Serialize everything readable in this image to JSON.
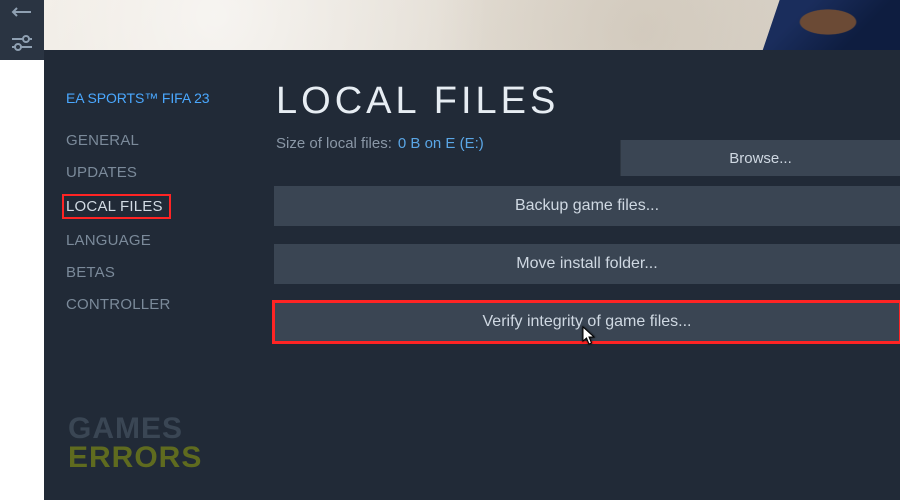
{
  "sidebar": {
    "game_title": "EA SPORTS™ FIFA 23",
    "items": [
      {
        "label": "GENERAL"
      },
      {
        "label": "UPDATES"
      },
      {
        "label": "LOCAL FILES"
      },
      {
        "label": "LANGUAGE"
      },
      {
        "label": "BETAS"
      },
      {
        "label": "CONTROLLER"
      }
    ],
    "selected_index": 2
  },
  "main": {
    "heading": "LOCAL FILES",
    "size_label": "Size of local files:",
    "size_value": "0 B on E (E:)",
    "browse_label": "Browse...",
    "buttons": {
      "backup": "Backup game files...",
      "move": "Move install folder...",
      "verify": "Verify integrity of game files..."
    }
  },
  "watermark": {
    "line1": "GAMES",
    "line2": "ERRORS"
  }
}
